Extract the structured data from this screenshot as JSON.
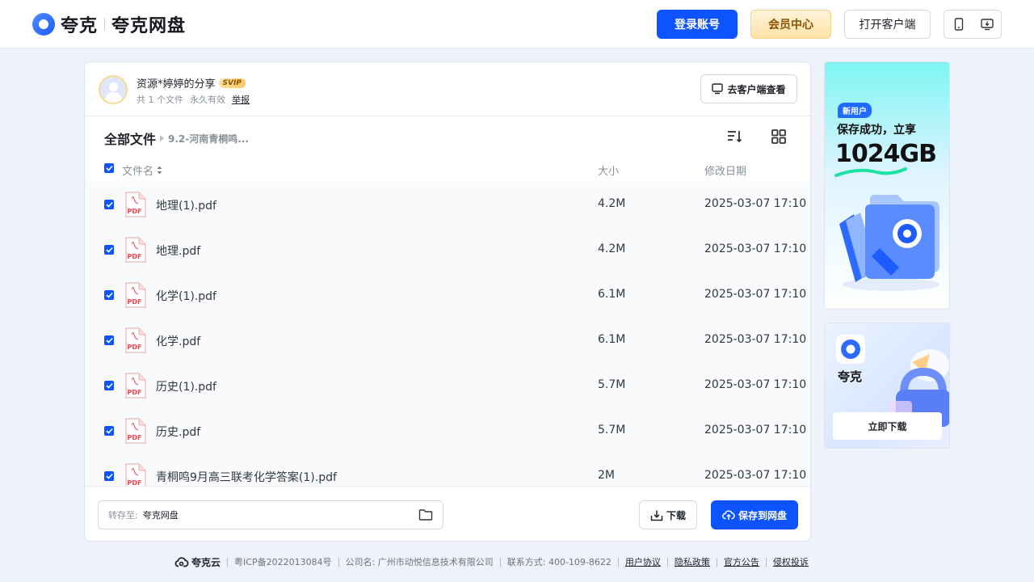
{
  "header": {
    "logo_text": "夸克",
    "logo_sub": "夸克网盘",
    "login_label": "登录账号",
    "vip_label": "会员中心",
    "client_label": "打开客户端"
  },
  "share": {
    "sharer": "资源*婷婷的分享",
    "badge": "SVIP",
    "file_count": "共 1 个文件",
    "validity": "永久有效",
    "report": "举报",
    "open_client": "去客户端查看"
  },
  "breadcrumb": {
    "root": "全部文件",
    "current": "9.2-河南青桐鸣..."
  },
  "columns": {
    "name": "文件名",
    "size": "大小",
    "date": "修改日期"
  },
  "files": [
    {
      "name": "地理(1).pdf",
      "size": "4.2M",
      "date": "2025-03-07 17:10",
      "icon": "pdf-icon"
    },
    {
      "name": "地理.pdf",
      "size": "4.2M",
      "date": "2025-03-07 17:10",
      "icon": "pdf-icon"
    },
    {
      "name": "化学(1).pdf",
      "size": "6.1M",
      "date": "2025-03-07 17:10",
      "icon": "pdf-icon"
    },
    {
      "name": "化学.pdf",
      "size": "6.1M",
      "date": "2025-03-07 17:10",
      "icon": "pdf-icon"
    },
    {
      "name": "历史(1).pdf",
      "size": "5.7M",
      "date": "2025-03-07 17:10",
      "icon": "pdf-icon"
    },
    {
      "name": "历史.pdf",
      "size": "5.7M",
      "date": "2025-03-07 17:10",
      "icon": "pdf-icon"
    },
    {
      "name": "青桐鸣9月高三联考化学答案(1).pdf",
      "size": "2M",
      "date": "2025-03-07 17:10",
      "icon": "pdf-icon"
    }
  ],
  "bottom_bar": {
    "save_to_label": "转存至:",
    "save_to_value": "夸克网盘",
    "download_label": "下载",
    "save_label": "保存到网盘"
  },
  "ads": {
    "promo_tag": "新用户",
    "promo_line1": "保存成功，立享",
    "promo_line2": "1024GB",
    "app_name": "夸克",
    "download_now": "立即下载"
  },
  "footer": {
    "brand": "夸克云",
    "icp": "粤ICP备2022013084号",
    "company": "公司名: 广州市动悦信息技术有限公司",
    "contact": "联系方式: 400-109-8622",
    "links": [
      "用户协议",
      "隐私政策",
      "官方公告",
      "侵权投诉"
    ]
  },
  "colors": {
    "accent": "#0d53ff",
    "vip_gold": "#fde3a8",
    "pdf_red": "#e5484d",
    "page_bg": "#eef3fb"
  }
}
